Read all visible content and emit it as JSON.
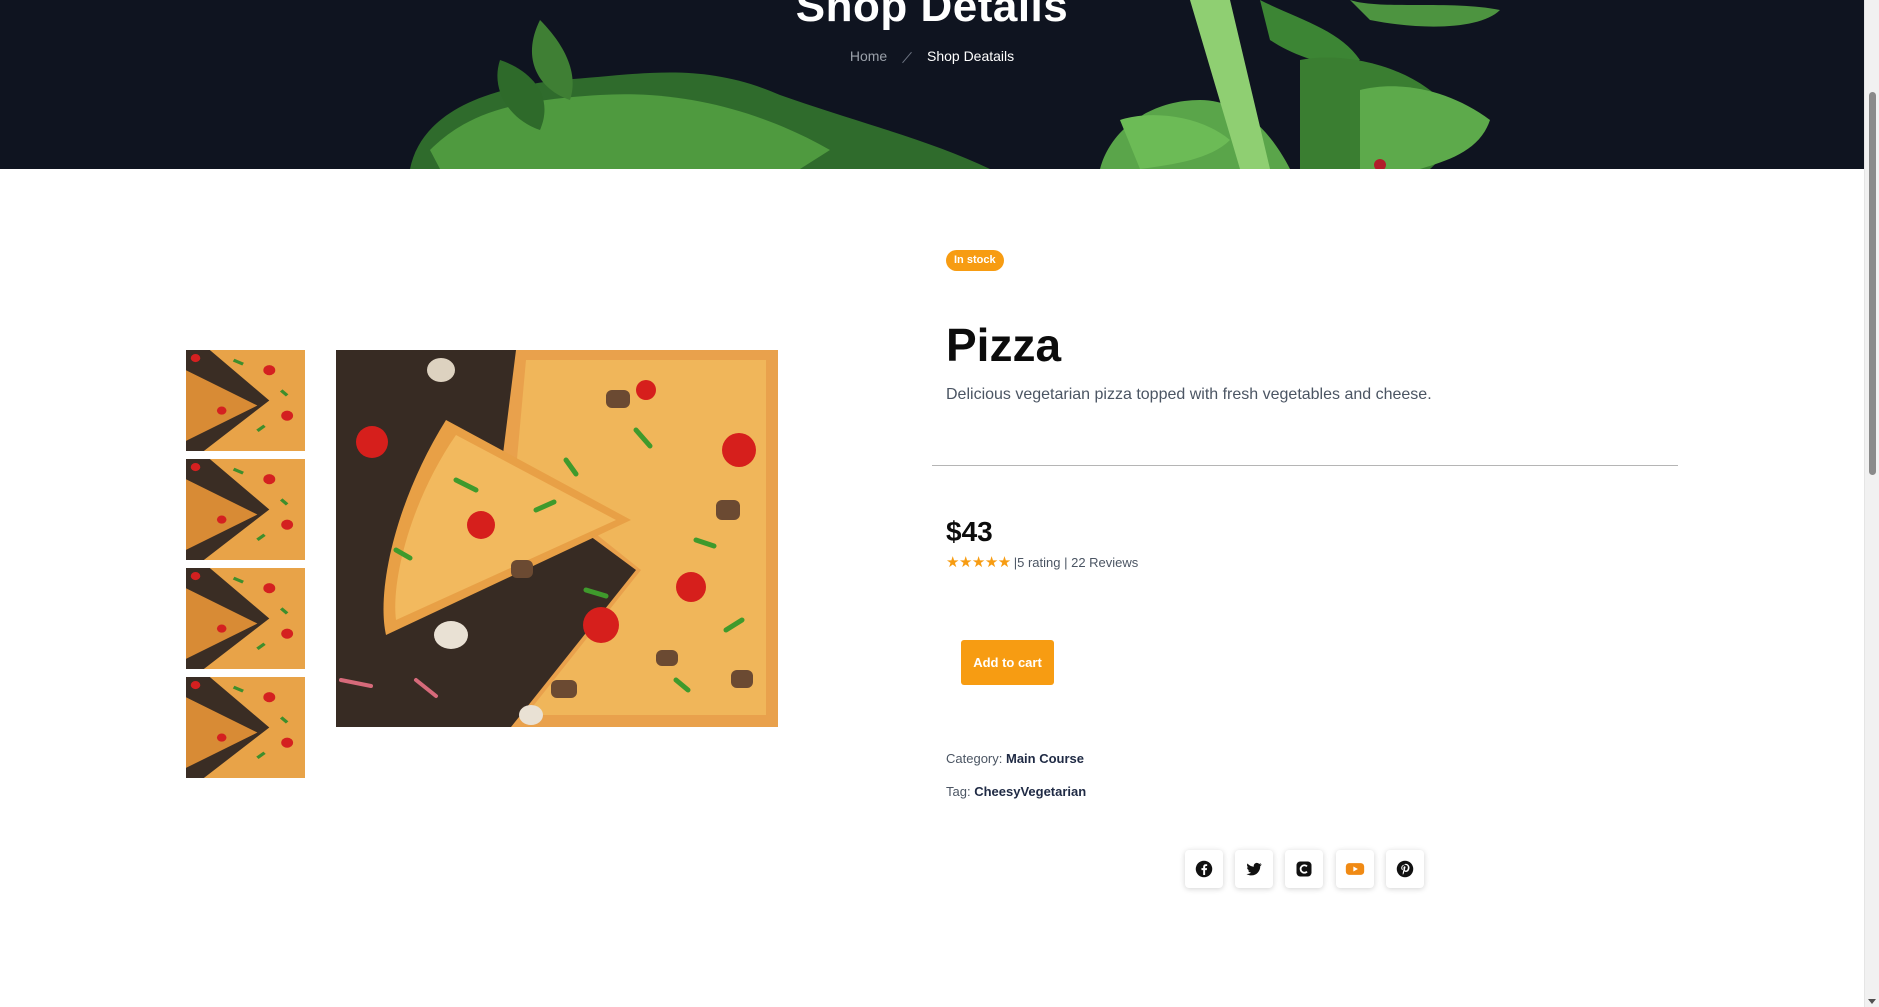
{
  "hero": {
    "title": "Shop Details",
    "breadcrumb": {
      "home": "Home",
      "current": "Shop Deatails"
    }
  },
  "gallery": {
    "thumbnails": [
      "pizza-thumb-1",
      "pizza-thumb-2",
      "pizza-thumb-3",
      "pizza-thumb-4"
    ],
    "main_image": "pizza-photo"
  },
  "product": {
    "stock_badge": "In stock",
    "name": "Pizza",
    "description": "Delicious vegetarian pizza topped with fresh vegetables and cheese.",
    "price": "$43",
    "stars": "★★★★★",
    "rating_text": "|5 rating | 22 Reviews",
    "add_to_cart": "Add to cart",
    "category_label": "Category:",
    "category_value": "Main Course",
    "tag_label": "Tag:",
    "tag_value": "CheesyVegetarian"
  },
  "social": [
    "facebook-icon",
    "twitter-icon",
    "instagram-icon",
    "youtube-icon",
    "pinterest-icon"
  ],
  "colors": {
    "accent": "#f79c12",
    "hero_bg": "#0f1420",
    "text_dark": "#0c0c0c",
    "text_muted": "#4b5563"
  }
}
